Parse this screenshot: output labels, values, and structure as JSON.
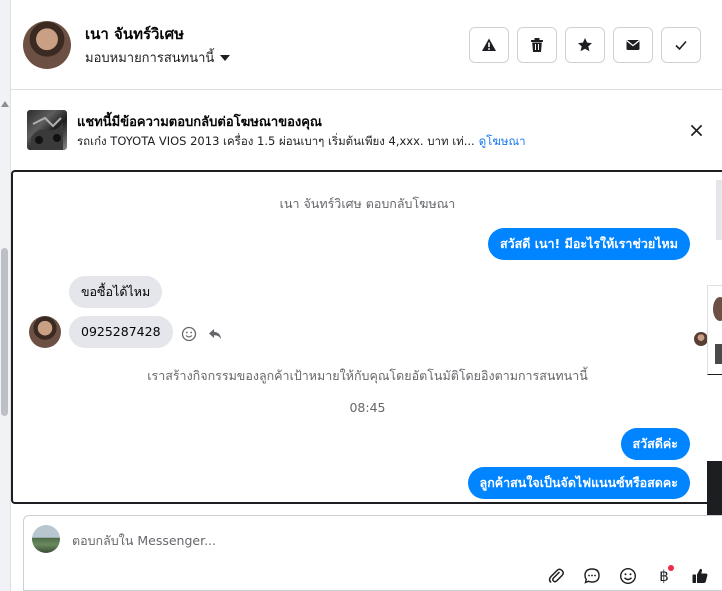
{
  "header": {
    "contact_name": "เนา จันทร์วิเศษ",
    "assign_label": "มอบหมายการสนทนานี้",
    "actions": [
      {
        "name": "report-button",
        "icon": "warning-icon"
      },
      {
        "name": "delete-button",
        "icon": "trash-icon"
      },
      {
        "name": "star-button",
        "icon": "star-icon"
      },
      {
        "name": "mark-unread-button",
        "icon": "envelope-icon"
      },
      {
        "name": "mark-done-button",
        "icon": "checkmark-icon"
      }
    ]
  },
  "ad_banner": {
    "title": "แชทนี้มีข้อความตอบกลับต่อโฆษณาของคุณ",
    "description": "รถเก๋ง TOYOTA VIOS 2013 เครื่อง 1.5 ผ่อนเบาๆ เริ่มต้นเพียง 4,xxx. บาท เท่...",
    "link_label": "ดูโฆษณา"
  },
  "conversation": {
    "ad_reply_notice": "เนา จันทร์วิเศษ ตอบกลับโฆษณา",
    "outgoing_greeting": "สวัสดี เนา! มีอะไรให้เราช่วยไหม",
    "incoming_messages": [
      "ขอซื้อได้ไหม",
      "0925287428"
    ],
    "audience_notice": "เราสร้างกิจกรรมของลูกค้าเป้าหมายให้กับคุณโดยอัตโนมัติโดยอิงตามการสนทนานี้",
    "timestamp": "08:45",
    "outgoing_messages": [
      "สวัสดีค่ะ",
      "ลูกค้าสนใจเป็นจัดไฟแนนซ์หรือสดคะ"
    ]
  },
  "composer": {
    "placeholder": "ตอบกลับใน Messenger...",
    "tools": [
      "attachment-icon",
      "saved-reply-icon",
      "emoji-icon",
      "payment-icon",
      "thumbs-up-icon"
    ],
    "currency_symbol": "฿"
  },
  "colors": {
    "accent": "#0084ff",
    "incoming_bubble": "#e4e6eb",
    "link": "#1877f2",
    "notification_dot": "#f02849"
  }
}
